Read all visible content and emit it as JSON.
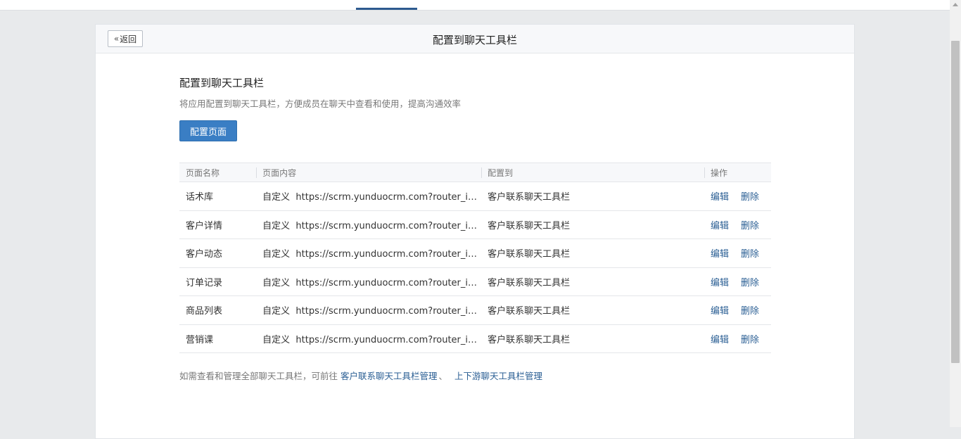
{
  "header": {
    "back_label": "返回",
    "title": "配置到聊天工具栏"
  },
  "section": {
    "title": "配置到聊天工具栏",
    "description": "将应用配置到聊天工具栏，方便成员在聊天中查看和使用，提高沟通效率",
    "config_button": "配置页面"
  },
  "table": {
    "columns": [
      "页面名称",
      "页面内容",
      "配置到",
      "操作"
    ],
    "rows": [
      {
        "name": "话术库",
        "content": "自定义  https://scrm.yunduocrm.com?router_id=...",
        "target": "客户联系聊天工具栏",
        "edit": "编辑",
        "delete": "删除"
      },
      {
        "name": "客户详情",
        "content": "自定义  https://scrm.yunduocrm.com?router_id=...",
        "target": "客户联系聊天工具栏",
        "edit": "编辑",
        "delete": "删除"
      },
      {
        "name": "客户动态",
        "content": "自定义  https://scrm.yunduocrm.com?router_id=...",
        "target": "客户联系聊天工具栏",
        "edit": "编辑",
        "delete": "删除"
      },
      {
        "name": "订单记录",
        "content": "自定义  https://scrm.yunduocrm.com?router_id=...",
        "target": "客户联系聊天工具栏",
        "edit": "编辑",
        "delete": "删除"
      },
      {
        "name": "商品列表",
        "content": "自定义  https://scrm.yunduocrm.com?router_id=...",
        "target": "客户联系聊天工具栏",
        "edit": "编辑",
        "delete": "删除"
      },
      {
        "name": "营销课",
        "content": "自定义  https://scrm.yunduocrm.com?router_id=...",
        "target": "客户联系聊天工具栏",
        "edit": "编辑",
        "delete": "删除"
      }
    ]
  },
  "footer": {
    "text": "如需查看和管理全部聊天工具栏，可前往 ",
    "link1": "客户联系聊天工具栏管理",
    "separator": "、 ",
    "link2": "上下游聊天工具栏管理"
  },
  "colors": {
    "primary": "#3a7ec4",
    "link": "#2b5f94",
    "tab_indicator": "#2d5a8f"
  }
}
